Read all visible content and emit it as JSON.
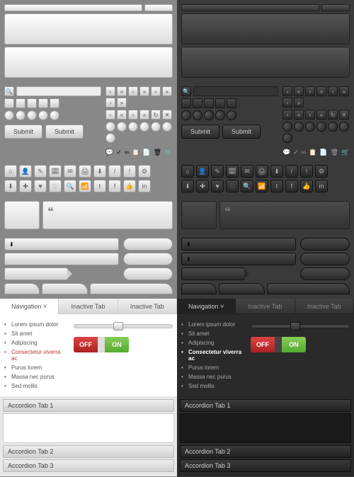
{
  "panels": {
    "small_count": 2,
    "large_count": 2
  },
  "search": {
    "placeholder": ""
  },
  "nav_arrows": [
    "‹",
    "«",
    "›",
    "»",
    "‹",
    "«",
    "›",
    "»",
    "↻",
    "✕"
  ],
  "nav_arrows2": [
    "‹",
    "«",
    "›",
    "»",
    "↻",
    "✕"
  ],
  "round_buttons_count": 12,
  "submit_label": "Submit",
  "mini_icons": [
    "💬",
    "✓",
    "∞",
    "📋",
    "📄",
    "🗑",
    "🛒"
  ],
  "icon_grid_row1": [
    "⌂",
    "👤",
    "✎",
    "🗓",
    "✉",
    "🖨",
    "⬇",
    "/",
    "!",
    "⚙"
  ],
  "icon_grid_row2": [
    "⬇",
    "✚",
    "♥",
    "♡",
    "🔍",
    "📶",
    "t",
    "f",
    "👍",
    "in"
  ],
  "quote_mark": "❝",
  "download_icon": "⬇",
  "tabs": {
    "active": "Navigation",
    "dropdown_icon": "˅",
    "inactive": [
      "Inactive Tab",
      "Inactive Tab"
    ]
  },
  "nav_items": [
    {
      "label": "Lorem ipsum dolor",
      "sel": false
    },
    {
      "label": "Sit amet",
      "sel": false
    },
    {
      "label": "Adipiscing",
      "sel": false
    },
    {
      "label": "Consectetur viverra ac",
      "sel": true
    },
    {
      "label": "Purus lorem",
      "sel": false
    },
    {
      "label": "Massa nec purus",
      "sel": false
    },
    {
      "label": "Sed mollis",
      "sel": false
    }
  ],
  "toggle": {
    "off": "OFF",
    "on": "ON"
  },
  "accordion": [
    "Accordion Tab 1",
    "Accordion Tab 2",
    "Accordion Tab 3"
  ]
}
